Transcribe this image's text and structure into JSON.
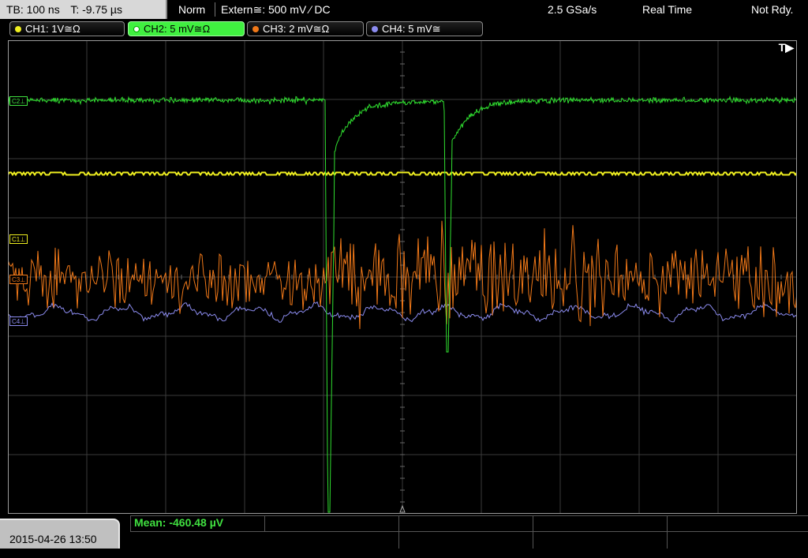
{
  "topbar": {
    "timebase": "TB: 100 ns",
    "time_offset": "T: -9.75 µs",
    "trigger_mode": "Norm",
    "trigger_source": "Extern≅: 500 mV ⁄ DC",
    "sample_rate": "2.5 GSa/s",
    "acq_mode": "Real Time",
    "status": "Not Rdy."
  },
  "channels": [
    {
      "label": "CH1: 1V≅Ω",
      "color": "#f0f020",
      "active": false
    },
    {
      "label": "CH2: 5 mV≅Ω",
      "color": "#40e040",
      "active": true
    },
    {
      "label": "CH3: 2 mV≅Ω",
      "color": "#f07818",
      "active": false
    },
    {
      "label": "CH4: 5 mV≅",
      "color": "#8c8cf0",
      "active": false
    }
  ],
  "markers": {
    "c1": "C1⊥",
    "c3": "C3⊥",
    "c4": "C4⊥",
    "c2": "C2⊥",
    "trigger_pos": "T▶"
  },
  "bottom": {
    "datetime": "2015-04-26 13:50",
    "measurement": "Mean: -460.48 µV"
  },
  "colors": {
    "ch1": "#f0f020",
    "ch2": "#30e030",
    "ch3": "#f07818",
    "ch4": "#8c8cf0",
    "grid": "#3a3a3a"
  }
}
